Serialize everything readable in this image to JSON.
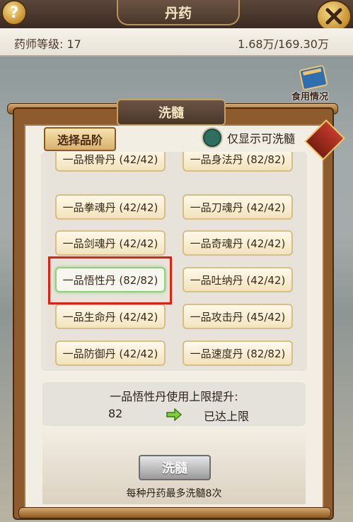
{
  "topbar": {
    "help_glyph": "?",
    "title": "丹药",
    "close_icon": "close-icon"
  },
  "info": {
    "level": "药师等级: 17",
    "money": "1.68万/169.30万"
  },
  "usage": {
    "label": "食用情况"
  },
  "modal": {
    "title": "洗髓",
    "grade_button": "选择品阶",
    "filter_label": "仅显示可洗髓",
    "pills": [
      "一品根骨丹 (42/42)",
      "一品身法丹 (82/82)",
      "一品拳魂丹 (42/42)",
      "一品刀魂丹 (42/42)",
      "一品剑魂丹 (42/42)",
      "一品奇魂丹 (42/42)",
      "一品悟性丹 (82/82)",
      "一品吐纳丹 (42/42)",
      "一品生命丹 (42/42)",
      "一品攻击丹 (45/42)",
      "一品防御丹 (42/42)",
      "一品速度丹 (82/82)"
    ],
    "selected_index": 6,
    "upgrade": {
      "title": "一品悟性丹使用上限提升:",
      "current": "82",
      "result": "已达上限"
    },
    "wash_button": "洗髓",
    "hint": "每种丹药最多洗髓8次"
  },
  "colors": {
    "accent": "#e02010",
    "frame": "#8e5b2e",
    "parchment": "#f3eee4"
  }
}
